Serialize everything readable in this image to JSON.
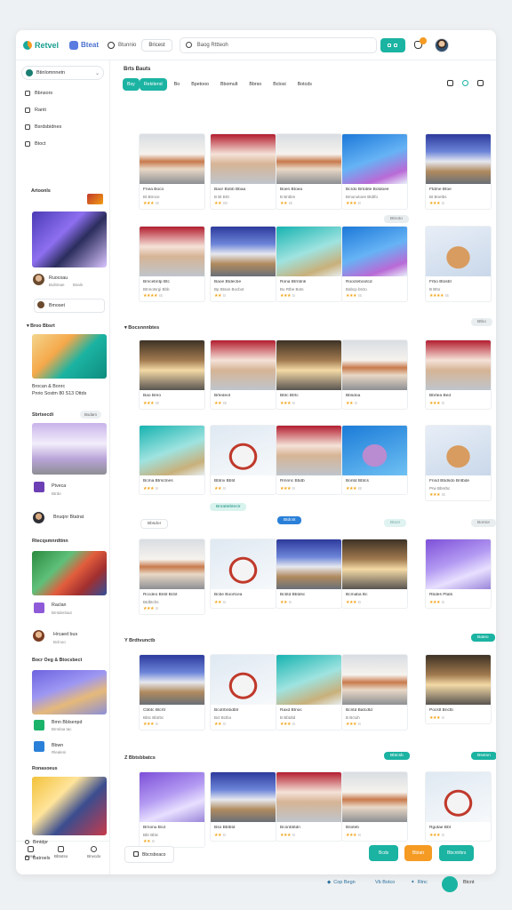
{
  "topbar": {
    "logo": "Retvel",
    "logo2": "Bteat",
    "nav_label": "Btunnio",
    "pill": "Bricest",
    "search_placeholder": "Baog Rttteoh"
  },
  "sidebar": {
    "workspace": "Btinlomnnetn",
    "items": [
      "Bbnsors",
      "Ranti",
      "Bsrdsbidnes",
      "Btoct"
    ],
    "section1": "Artoonls",
    "profile1": {
      "name": "Ruocoau",
      "sub": "Bulitmae",
      "sub2": "Bsaln"
    },
    "row_label": "Bmoset",
    "section2": "Broo Bbsrt",
    "caption2": "Brocan & Bonrc",
    "caption2b": "Pnrio Sostm 80 S13 Ottds",
    "section3": "Sbrtsecdi",
    "chip3": "Bsdam",
    "p3_title": "Ptveca",
    "p3_sub": "Btrde",
    "p4_title": "Bnuqnr Btatrat",
    "section4": "Rtecqsmnrdtinn",
    "p5_title": "Raclan",
    "p5_sub": "Bmtdenlaut",
    "p6_title": "Hrcaed bus",
    "p6_sub": "Bclnoo",
    "section5": "Bocr Oeg & Btocsbect",
    "p7_title": "Bmn Bblsenpd",
    "p7_sub": "Bmnlaa tac",
    "p8_title": "Bbwn",
    "p8_sub": "Rlealeni",
    "section6": "Ronasoeus",
    "tabs": [
      "Bosd",
      "Bbtotso",
      "Bnvcdo"
    ],
    "footer_items": [
      "Bmtdpr",
      "Batroels"
    ]
  },
  "main": {
    "title": "Brts Bauts",
    "filters": [
      "Bsy",
      "Rekitend",
      "Bo",
      "Bpetooo",
      "Bbomult",
      "Bbrso",
      "Bctosi",
      "Botcds"
    ],
    "section_labels": [
      "Bocsnnnbtes",
      "Y Brdtvunctb",
      "Z Bbtsbbatcs"
    ],
    "buttons": {
      "row1_more": "Btnoto",
      "row2_more": "Btbo",
      "row3_a": "Bbsdor",
      "row3_b": "Bnrattebtectr",
      "row3_c": "Btdcst",
      "row3_d": "Btosr",
      "row3_e": "Bontor",
      "row4_more": "Bateo",
      "row5_a": "Bbtcsb",
      "row5_b": "Bseton"
    },
    "cards": [
      {
        "title": "Fnea Boco",
        "meta": "Bt Btroce",
        "stars": "★★★",
        "count": "Bt"
      },
      {
        "title": "Baor Bobb Bbaa",
        "meta": "B  Bt Brtt",
        "stars": "★★",
        "count": "B0"
      },
      {
        "title": "Boen Btoea",
        "meta": "B Bntbm",
        "stars": "★★",
        "count": "Bt"
      },
      {
        "title": "Bcrdo Brtobte Botdoee",
        "meta": "Bmunotoee Btdtfo",
        "stars": "★★★",
        "count": "B"
      },
      {
        "title": "Ftdme Btoe",
        "meta": "Bt Bnetbs",
        "stars": "★★★",
        "count": "B"
      },
      {
        "title": "Bmcebntp Btc",
        "meta": "Btnnotsrgi Bbb",
        "stars": "★★★★",
        "count": "Bt"
      },
      {
        "title": "Baoe Btdecbe",
        "meta": "Bp Btsan Bocbot",
        "stars": "★★",
        "count": "B"
      },
      {
        "title": "Rona Btrnbnk",
        "meta": "Bu Rtbe Bots",
        "stars": "★★★",
        "count": "B"
      },
      {
        "title": "Rooctebootcd",
        "meta": "Babcp btcto",
        "stars": "★★★",
        "count": "Bt"
      },
      {
        "title": "Frbo Btosbt",
        "meta": "B Btto",
        "stars": "★★★★",
        "count": "Bt"
      },
      {
        "title": "Bao Breo",
        "meta": "",
        "stars": "★★★",
        "count": "Bt"
      },
      {
        "title": "Brtedeot",
        "meta": "",
        "stars": "★★",
        "count": "Bt"
      },
      {
        "title": "Bbtc Btrtc",
        "meta": "",
        "stars": "★★★",
        "count": "B"
      },
      {
        "title": "Bbsdoa",
        "meta": "",
        "stars": "★★",
        "count": "B"
      },
      {
        "title": "Bbrtea Bed",
        "meta": "",
        "stars": "★★★",
        "count": "B"
      },
      {
        "title": "Bcma Btrsctnes",
        "meta": "",
        "stars": "★★★",
        "count": "B"
      },
      {
        "title": "Bbtnv Bbtit",
        "meta": "",
        "stars": "★★",
        "count": "B"
      },
      {
        "title": "Rmnnc Bbdb",
        "meta": "",
        "stars": "★★★",
        "count": "B"
      },
      {
        "title": "Bontd Bbtcs",
        "meta": "",
        "stars": "★★★",
        "count": "Bt"
      },
      {
        "title": "Fnnd Bbdsdo Bntbde",
        "meta": "Prw Bbnrbc",
        "stars": "★★★",
        "count": "Bt"
      },
      {
        "title": "Rccdeo Bnbt Bcbt",
        "meta": "Btdbtchs",
        "stars": "★★★",
        "count": "B"
      },
      {
        "title": "Bcbe Boortcea",
        "meta": "",
        "stars": "★★",
        "count": "B"
      },
      {
        "title": "Bcbtd Bbtdsc",
        "meta": "",
        "stars": "★★",
        "count": "B"
      },
      {
        "title": "Bcmaba Bc",
        "meta": "",
        "stars": "★★★",
        "count": "B"
      },
      {
        "title": "Rbdes Ptats",
        "meta": "",
        "stars": "★★★",
        "count": "B"
      },
      {
        "title": "Cbbtc Btcrtr",
        "meta": "Bbtc Bbtrbc",
        "stars": "★★★",
        "count": "B"
      },
      {
        "title": "Bcotrbnbdbtr",
        "meta": "Bct Bctbo",
        "stars": "★★",
        "count": "B"
      },
      {
        "title": "Raxd Btnoc",
        "meta": "B Bbtdtd",
        "stars": "★★★",
        "count": "B"
      },
      {
        "title": "Bcntd Batcdtd",
        "meta": "B Bctoh",
        "stars": "★★★",
        "count": "B"
      },
      {
        "title": "Pocstt Bnctb",
        "meta": "",
        "stars": "★★★",
        "count": "B"
      },
      {
        "title": "Brnonu Bcd",
        "meta": "Bbr Bbtc",
        "stars": "★★",
        "count": "B"
      },
      {
        "title": "Bso Bbtbtd",
        "meta": "",
        "stars": "★★",
        "count": "B"
      },
      {
        "title": "Bconbbtdn",
        "meta": "",
        "stars": "★★★",
        "count": "B"
      },
      {
        "title": "Bsoteb",
        "meta": "",
        "stars": "★★★",
        "count": "B"
      },
      {
        "title": "Rgutae Bbt",
        "meta": "",
        "stars": "★★★",
        "count": "B"
      }
    ]
  },
  "footer": {
    "left_btn": "Bbcrsboaco",
    "btn_teal": "Bcds",
    "btn_orange": "Bbtatr",
    "btn_teal2": "Bbcntrbrs"
  },
  "outside": {
    "links": [
      "Cop Begn",
      "Vb Botco",
      "Rtnc"
    ],
    "end": "Btcnt"
  },
  "colors": {
    "accent": "#1bb3a2",
    "orange": "#f59b23",
    "blue": "#2a80d8"
  }
}
